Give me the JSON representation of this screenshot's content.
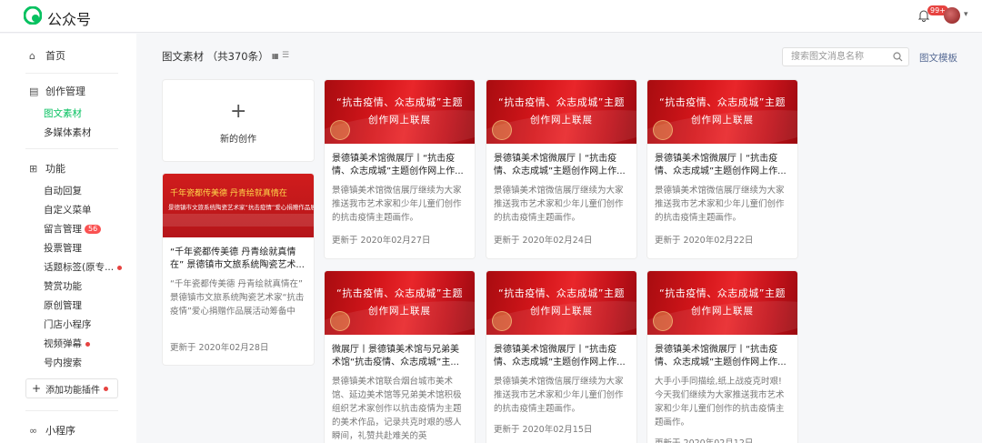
{
  "app": {
    "brand": "公众号",
    "notification_count": "99+",
    "colors": {
      "accent": "#07c160",
      "cover_red": "#d5161b",
      "badge": "#fa5151",
      "link": "#576b95"
    }
  },
  "sidebar": {
    "home": "首页",
    "creation": {
      "title": "创作管理",
      "items": [
        "图文素材",
        "多媒体素材"
      ]
    },
    "features": {
      "title": "功能",
      "items": [
        {
          "label": "自动回复"
        },
        {
          "label": "自定义菜单"
        },
        {
          "label": "留言管理",
          "badge": "56"
        },
        {
          "label": "投票管理"
        },
        {
          "label": "话题标签(原专...",
          "dot": true
        },
        {
          "label": "赞赏功能"
        },
        {
          "label": "原创管理"
        },
        {
          "label": "门店小程序"
        },
        {
          "label": "视频弹幕",
          "dot": true
        },
        {
          "label": "号内搜索"
        }
      ]
    },
    "add_plugin": "添加功能插件",
    "mini_program": "小程序"
  },
  "main": {
    "title": "图文素材 （共370条）",
    "search_placeholder": "搜索图文消息名称",
    "template_link": "图文模板",
    "new_creation": "新的创作",
    "cover_line1": "“抗击疫情、众志成城”主题",
    "cover_line2": "创作网上联展",
    "cards": [
      {
        "title": "景德镇美术馆微展厅丨“抗击疫情、众志成城”主题创作网上作...",
        "desc": "景德镇美术馆微信展厅继续为大家推送我市艺术家和少年儿童们创作的抗击疫情主题画作。",
        "date": "更新于 2020年02月27日"
      },
      {
        "title": "景德镇美术馆微展厅丨“抗击疫情、众志成城”主题创作网上作...",
        "desc": "景德镇美术馆微信展厅继续为大家推送我市艺术家和少年儿童们创作的抗击疫情主题画作。",
        "date": "更新于 2020年02月24日"
      },
      {
        "title": "景德镇美术馆微展厅丨“抗击疫情、众志成城”主题创作网上作...",
        "desc": "景德镇美术馆微信展厅继续为大家推送我市艺术家和少年儿童们创作的抗击疫情主题画作。",
        "date": "更新于 2020年02月22日"
      },
      {
        "title": "“千年瓷都传美德 丹青绘就真情在” 景德镇市文旅系统陶瓷艺术...",
        "desc": "“千年瓷都传美德 丹青绘就真情在” 景德镇市文旅系统陶瓷艺术家“抗击疫情”爱心捐赠作品展活动筹备中",
        "date": "更新于 2020年02月28日",
        "cover_calligraphy": "千年瓷都传美德  丹青绘就真情在",
        "cover_sub": "景德镇市文旅系统陶瓷艺术家“抗击疫情”爱心捐赠作品展"
      },
      {
        "title": "微展厅丨景德镇美术馆与兄弟美术馆“抗击疫情、众志成城”主...",
        "desc": "景德镇美术馆联合烟台城市美术馆、延边美术馆等兄弟美术馆积极组织艺术家创作以抗击疫情为主题的美术作品，记录共克时艰的感人瞬间，礼赞共赴难关的英",
        "date": ""
      },
      {
        "title": "景德镇美术馆微展厅丨“抗击疫情、众志成城”主题创作网上作...",
        "desc": "景德镇美术馆微信展厅继续为大家推送我市艺术家和少年儿童们创作的抗击疫情主题画作。",
        "date": "更新于 2020年02月15日"
      },
      {
        "title": "景德镇美术馆微展厅丨“抗击疫情、众志成城”主题创作网上作...",
        "desc": "大手小手同描绘,纸上战疫克时艰! 今天我们继续为大家推送我市艺术家和少年儿童们创作的抗击疫情主题画作。",
        "date": "更新于 2020年02月12日"
      }
    ]
  }
}
